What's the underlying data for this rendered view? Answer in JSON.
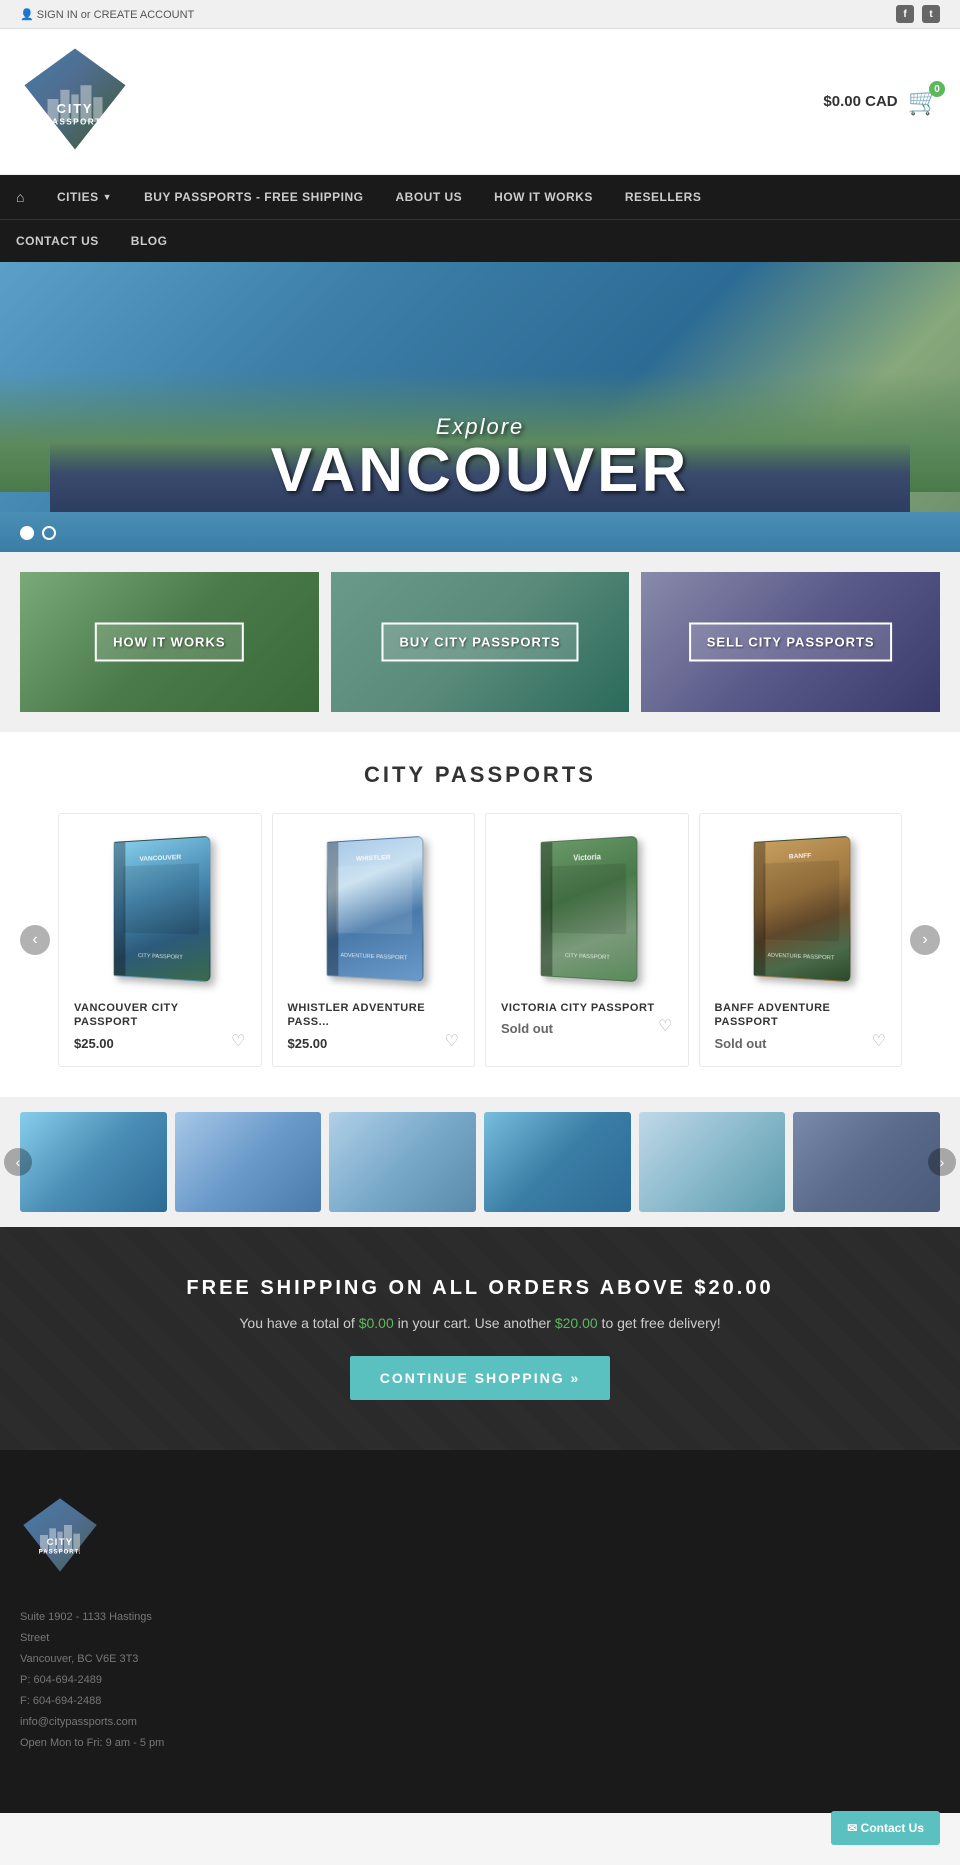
{
  "topbar": {
    "sign_in": "SIGN IN",
    "or": " or ",
    "create_account": "CREATE ACCOUNT"
  },
  "header": {
    "cart_amount": "$0.00 CAD",
    "cart_count": "0"
  },
  "nav": {
    "items": [
      {
        "label": "CITIES",
        "has_dropdown": true
      },
      {
        "label": "BUY PASSPORTS - FREE SHIPPING",
        "has_dropdown": false
      },
      {
        "label": "ABOUT US",
        "has_dropdown": false
      },
      {
        "label": "HOW IT WORKS",
        "has_dropdown": false
      },
      {
        "label": "RESELLERS",
        "has_dropdown": false
      }
    ],
    "row2": [
      {
        "label": "CONTACT US"
      },
      {
        "label": "BLOG"
      }
    ]
  },
  "hero": {
    "explore_text": "Explore",
    "city_name": "VANCOUVER",
    "dots": [
      true,
      false
    ]
  },
  "features": [
    {
      "label": "HOW IT\nWORKS"
    },
    {
      "label": "BUY CITY\nPASSPORTS"
    },
    {
      "label": "SELL CITY\nPASSPORTS"
    }
  ],
  "products_section": {
    "title": "CITY PASSPORTS",
    "products": [
      {
        "name": "VANCOUVER CITY PASSPORT",
        "price": "$25.00",
        "sold_out": false,
        "type": "van"
      },
      {
        "name": "WHISTLER ADVENTURE PASS...",
        "price": "$25.00",
        "sold_out": false,
        "type": "whi"
      },
      {
        "name": "VICTORIA CITY PASSPORT",
        "price": "",
        "sold_out": true,
        "type": "vic"
      },
      {
        "name": "BANFF ADVENTURE PASSPORT",
        "price": "",
        "sold_out": true,
        "type": "ban"
      }
    ]
  },
  "shipping": {
    "title": "FREE SHIPPING ON ALL ORDERS ABOVE $20.00",
    "subtitle_pre": "You have a total of ",
    "amount1": "$0.00",
    "subtitle_mid": " in your cart. Use another ",
    "amount2": "$20.00",
    "subtitle_post": " to get free delivery!",
    "button_label": "CONTINUE SHOPPING »"
  },
  "footer": {
    "address_line1": "Suite 1902 - 1133 Hastings",
    "address_line2": "Street",
    "address_line3": "Vancouver, BC V6E 3T3",
    "phone": "P: 604-694-2489",
    "fax": "F: 604-694-2488",
    "email": "info@citypassports.com",
    "hours": "Open Mon to Fri: 9 am - 5 pm"
  },
  "contact_button": {
    "label": "✉ Contact Us"
  }
}
